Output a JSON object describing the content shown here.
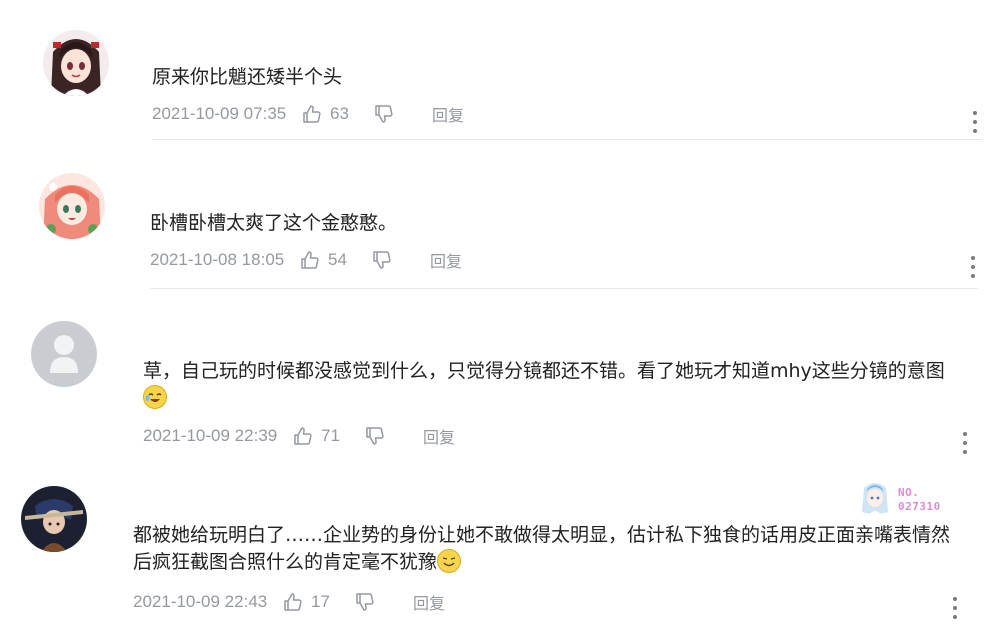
{
  "comments": [
    {
      "text_lines": [
        "原来你比魈还矮半个头"
      ],
      "date": "2021-10-09 07:35",
      "likes": "63",
      "reply_label": "回复",
      "avatar_icon": "anime-girl-avatar-icon"
    },
    {
      "text_lines": [
        "卧槽卧槽太爽了这个金憨憨。"
      ],
      "date": "2021-10-08 18:05",
      "likes": "54",
      "reply_label": "回复",
      "avatar_icon": "anime-girl-pink-hair-avatar-icon"
    },
    {
      "text_lines": [
        "草，自己玩的时候都没感觉到什么，只觉得分镜都还不错。看了她玩才知道mhy这些分镜的意图"
      ],
      "emoji": "laugh-cry-emoji",
      "date": "2021-10-09 22:39",
      "likes": "71",
      "reply_label": "回复",
      "avatar_icon": "default-user-avatar-icon"
    },
    {
      "text_lines": [
        "都被她给玩明白了……企业势的身份让她不敢做得太明显，估计私下独食的话用皮正面亲嘴表情然",
        "后疯狂截图合照什么的肯定毫不犹豫"
      ],
      "emoji": "smile-emoji",
      "date": "2021-10-09 22:43",
      "likes": "17",
      "reply_label": "回复",
      "avatar_icon": "dark-character-avatar-icon",
      "badge": {
        "no_label": "NO.",
        "number": "027310"
      }
    }
  ],
  "colors": {
    "meta": "#9499a0",
    "text": "#222222",
    "divider": "#e5e9ef",
    "badge": "#e18ad4"
  }
}
